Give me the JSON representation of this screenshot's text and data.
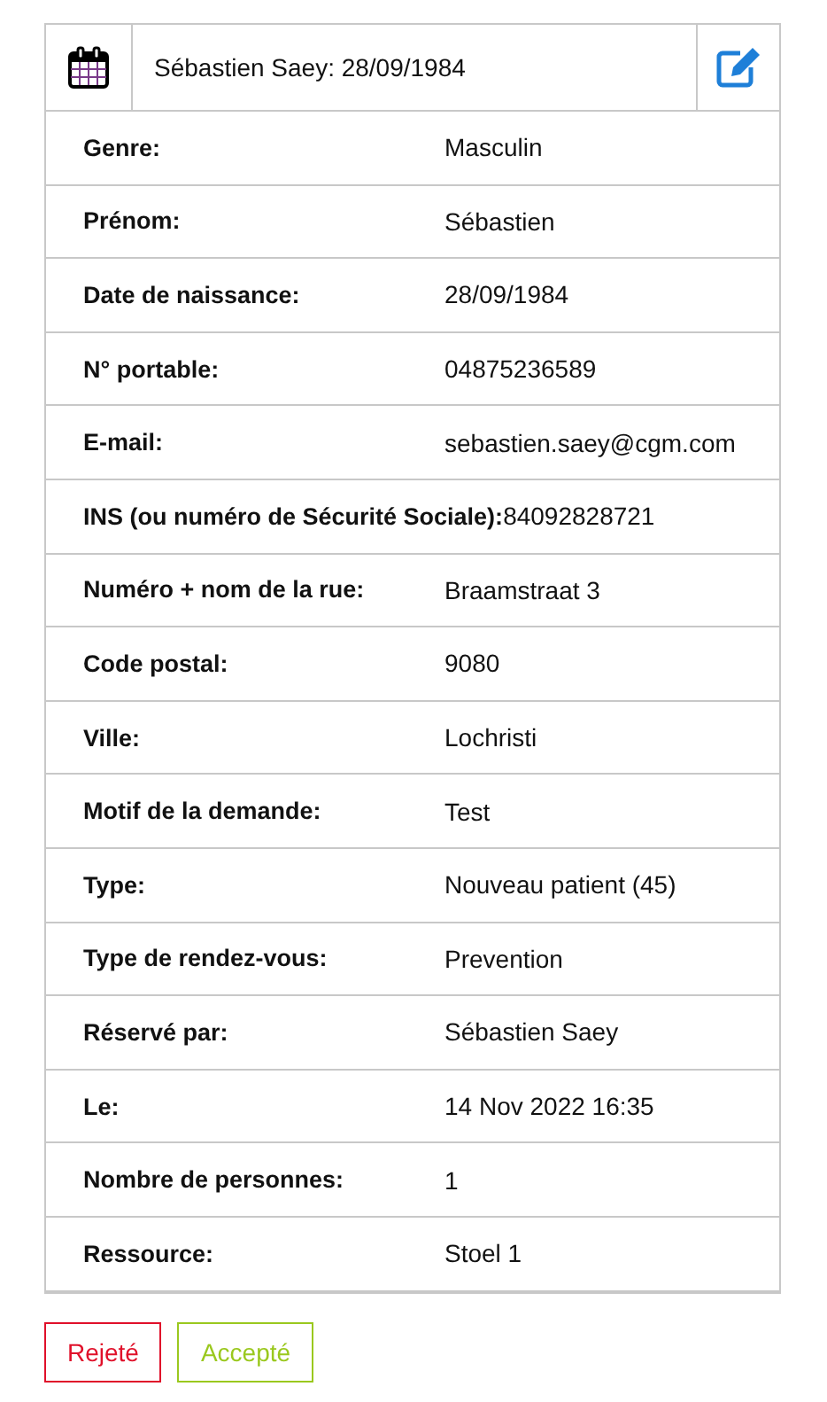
{
  "header": {
    "title": "Sébastien Saey: 28/09/1984"
  },
  "fields": [
    {
      "label": "Genre:",
      "value": "Masculin"
    },
    {
      "label": "Prénom:",
      "value": "Sébastien"
    },
    {
      "label": "Date de naissance:",
      "value": "28/09/1984"
    },
    {
      "label": "N° portable:",
      "value": "04875236589"
    },
    {
      "label": "E-mail:",
      "value": "sebastien.saey@cgm.com"
    },
    {
      "label": "INS (ou numéro de Sécurité Sociale):",
      "value": "84092828721"
    },
    {
      "label": "Numéro + nom de la rue:",
      "value": "Braamstraat 3"
    },
    {
      "label": "Code postal:",
      "value": "9080"
    },
    {
      "label": "Ville:",
      "value": "Lochristi"
    },
    {
      "label": "Motif de la demande:",
      "value": "Test"
    },
    {
      "label": "Type:",
      "value": "Nouveau patient (45)"
    },
    {
      "label": "Type de rendez-vous:",
      "value": "Prevention"
    },
    {
      "label": "Réservé par:",
      "value": "Sébastien Saey"
    },
    {
      "label": "Le:",
      "value": "14 Nov 2022 16:35"
    },
    {
      "label": "Nombre de personnes:",
      "value": "1"
    },
    {
      "label": "Ressource:",
      "value": "Stoel 1"
    }
  ],
  "buttons": [
    {
      "label": "Rejeté",
      "kind": "reject"
    },
    {
      "label": "Accepté",
      "kind": "accept"
    }
  ]
}
